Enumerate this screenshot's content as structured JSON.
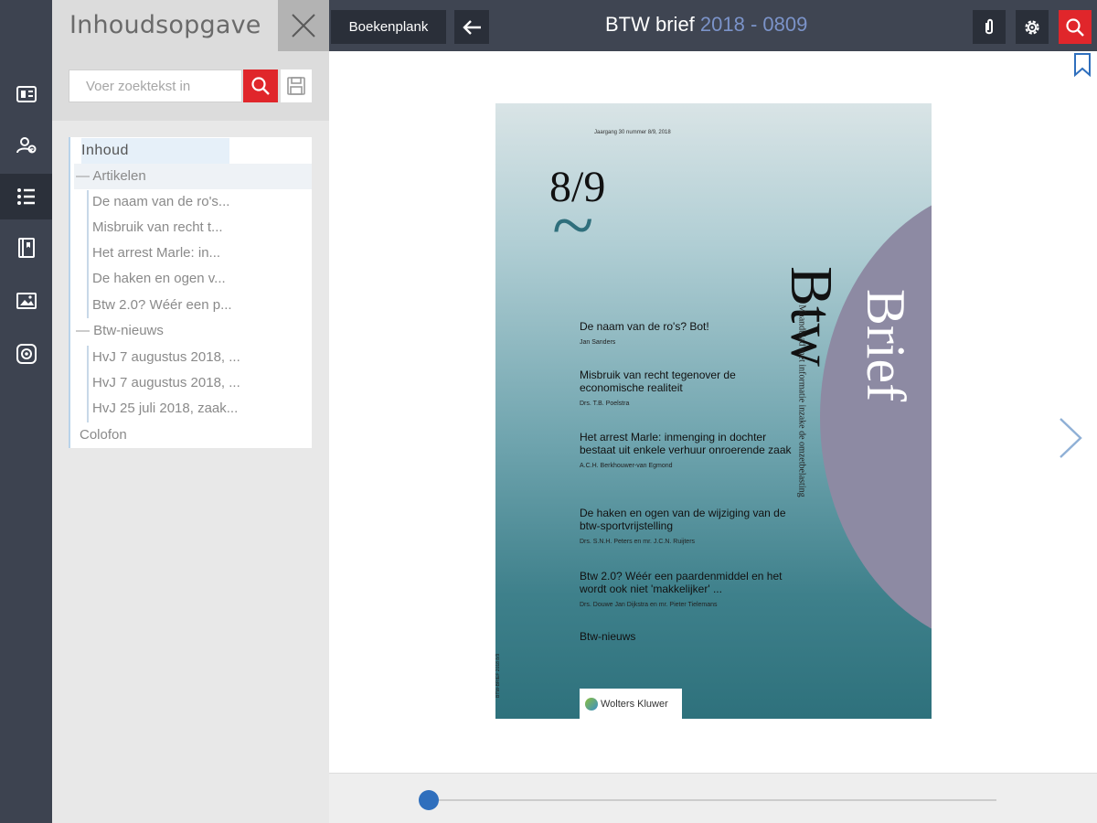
{
  "rail": {
    "items": [
      {
        "name": "overview-icon"
      },
      {
        "name": "users-icon"
      },
      {
        "name": "toc-list-icon"
      },
      {
        "name": "book-icon"
      },
      {
        "name": "image-icon"
      },
      {
        "name": "settings-circle-icon"
      }
    ],
    "active_index": 2
  },
  "toc": {
    "title": "Inhoudsopgave",
    "search_placeholder": "Voer zoektekst in",
    "items": {
      "inhoud": "Inhoud",
      "artikelen": "Artikelen",
      "art1": "De naam van de ro's...",
      "art2": "Misbruik van recht t...",
      "art3": "Het arrest Marle: in...",
      "art4": "De haken en ogen v...",
      "art5": "Btw 2.0? Wéér een p...",
      "btw_nieuws": "Btw-nieuws",
      "news1": "HvJ 7 augustus 2018, ...",
      "news2": "HvJ 7 augustus 2018, ...",
      "news3": "HvJ 25 juli 2018, zaak...",
      "colofon": "Colofon"
    }
  },
  "topbar": {
    "shelf_label": "Boekenplank",
    "title": "BTW brief",
    "title_meta": "2018 - 0809"
  },
  "cover": {
    "issue_line": "Jaargang 30 nummer 8/9, 2018",
    "number": "8/9",
    "tilde": "~",
    "masthead_1": "Btw",
    "masthead_2": "Brief",
    "tagline": "Maandblad met informatie inzake de omzetbelasting",
    "spine": "BTW-BRIEF 2018 8/9",
    "articles": [
      {
        "title": "De naam van de ro's? Bot!",
        "author": "Jan Sanders"
      },
      {
        "title": "Misbruik van recht tegenover de economische realiteit",
        "author": "Drs. T.B. Poelstra"
      },
      {
        "title": "Het arrest Marle: inmenging in dochter bestaat uit enkele verhuur onroerende zaak",
        "author": "A.C.H. Berkhouwer-van Egmond"
      },
      {
        "title": "De haken en ogen van de wijziging van de btw-sportvrijstelling",
        "author": "Drs. S.N.H. Peters en mr. J.C.N. Ruijters"
      },
      {
        "title": "Btw 2.0? Wéér een paardenmiddel en het wordt ook niet 'makkelijker' ...",
        "author": "Drs. Douwe Jan Dijkstra en mr. Pieter Tielemans"
      }
    ],
    "news": "Btw-nieuws",
    "publisher": "Wolters Kluwer"
  },
  "colors": {
    "accent_red": "#e0262b",
    "topbar": "#3f4552",
    "rail": "#3d4350",
    "slider": "#2f6fbd"
  },
  "slider": {
    "position_fraction": 0.0
  }
}
